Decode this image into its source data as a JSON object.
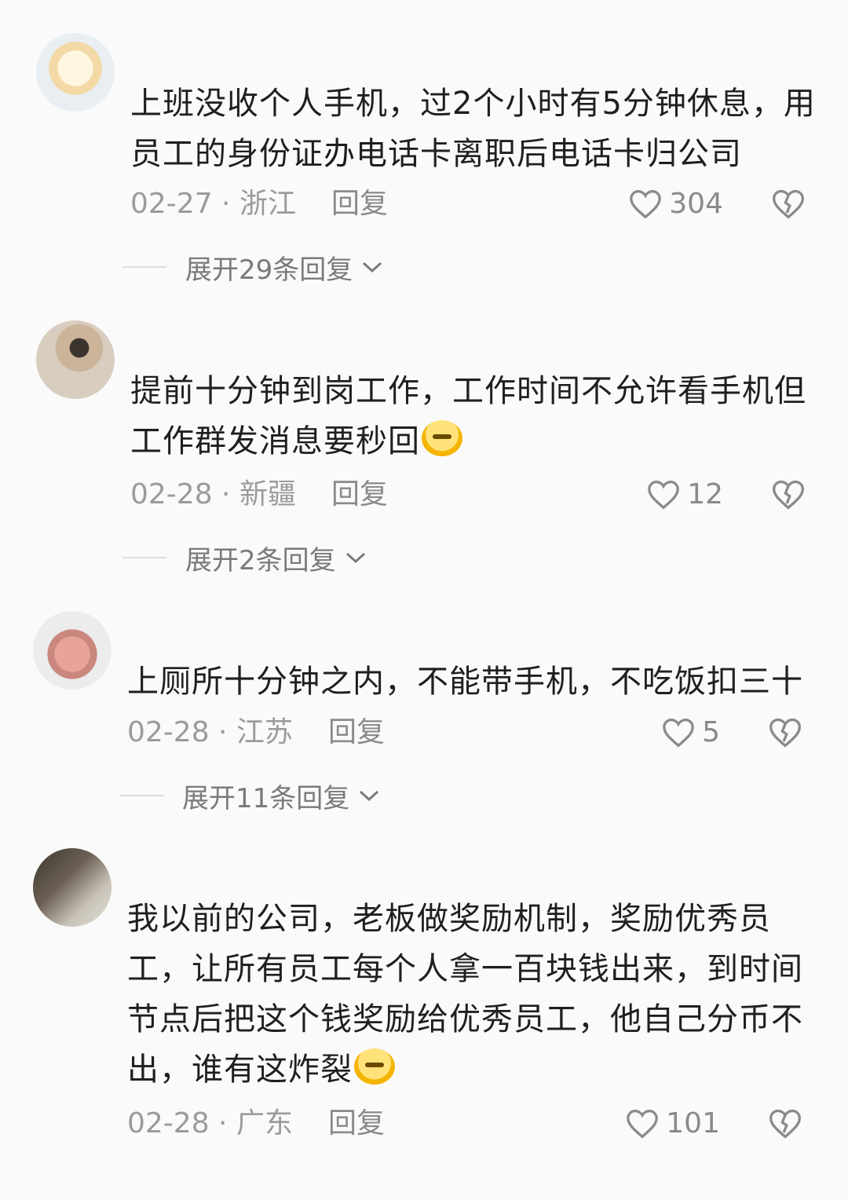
{
  "comments": [
    {
      "text": "上班没收个人手机，过2个小时有5分钟休息，用员工的身份证办电话卡离职后电话卡归公司",
      "date_region": "02-27 · 浙江",
      "reply_label": "回复",
      "likes": "304",
      "expand_label": "展开29条回复"
    },
    {
      "text": "提前十分钟到岗工作，工作时间不允许看手机但工作群发消息要秒回",
      "date_region": "02-28 · 新疆",
      "reply_label": "回复",
      "likes": "12",
      "expand_label": "展开2条回复"
    },
    {
      "text": "上厕所十分钟之内，不能带手机，不吃饭扣三十",
      "date_region": "02-28 · 江苏",
      "reply_label": "回复",
      "likes": "5",
      "expand_label": "展开11条回复"
    },
    {
      "text": "我以前的公司，老板做奖励机制，奖励优秀员工，让所有员工每个人拿一百块钱出来，到时间节点后把这个钱奖励给优秀员工，他自己分币不出，谁有这炸裂",
      "date_region": "02-28 · 广东",
      "reply_label": "回复",
      "likes": "101"
    }
  ]
}
